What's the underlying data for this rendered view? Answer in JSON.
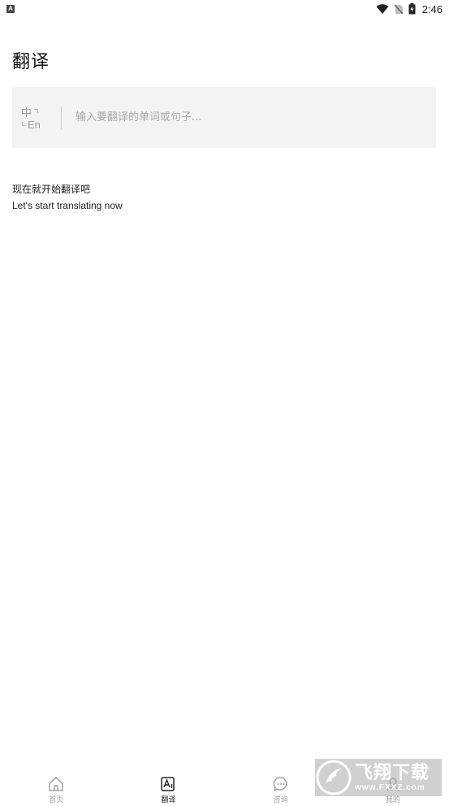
{
  "status_bar": {
    "notification_icon": "A",
    "time": "2:46",
    "icons": [
      "wifi-icon",
      "no-sim-icon",
      "battery-charging-icon"
    ]
  },
  "page": {
    "title": "翻译"
  },
  "translate_card": {
    "lang_from": "中",
    "lang_to": "En",
    "placeholder": "输入要翻译的单词或句子..."
  },
  "prompt": {
    "zh": "现在就开始翻译吧",
    "en": "Let's start translating now"
  },
  "bottom_nav": {
    "items": [
      {
        "label": "首页",
        "icon": "home-icon",
        "active": false
      },
      {
        "label": "翻译",
        "icon": "translate-icon",
        "active": true
      },
      {
        "label": "咨询",
        "icon": "chat-bubble-icon",
        "active": false
      },
      {
        "label": "我的",
        "icon": "profile-icon",
        "active": false
      }
    ]
  },
  "watermark": {
    "brand": "飞翔下载",
    "url": "www.FXXZ.com"
  }
}
